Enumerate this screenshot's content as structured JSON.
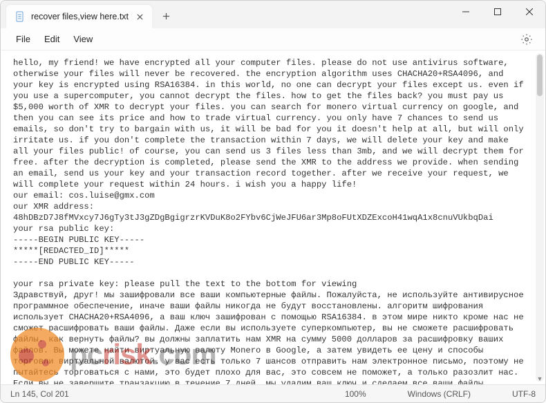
{
  "titlebar": {
    "tab_title": "recover files,view here.txt"
  },
  "menubar": {
    "file": "File",
    "edit": "Edit",
    "view": "View"
  },
  "body_text": "hello, my friend! we have encrypted all your computer files. please do not use antivirus software, otherwise your files will never be recovered. the encryption algorithm uses CHACHA20+RSA4096, and your key is encrypted using RSA16384. in this world, no one can decrypt your files except us. even if you use a supercomputer, you cannot decrypt the files. how to get the files back? you must pay us $5,000 worth of XMR to decrypt your files. you can search for monero virtual currency on google, and then you can see its price and how to trade virtual currency. you only have 7 chances to send us emails, so don't try to bargain with us, it will be bad for you it doesn't help at all, but will only irritate us. if you don't complete the transaction within 7 days, we will delete your key and make all your files public! of course, you can send us 3 files less than 3mb, and we will decrypt them for free. after the decryption is completed, please send the XMR to the address we provide. when sending an email, send us your key and your transaction record together. after we receive your request, we will complete your request within 24 hours. i wish you a happy life!\nour email: cos.luise@gmx.com\nour XMR address:\n48hDBzD7J8fMVxcy7J6gTy3tJ3gZDgBgigrzrKVDuK8o2FYbv6CjWeJFU6ar3Mp8oFUtXDZExcoH41wqA1x8cnuVUkbqDai\nyour rsa public key:\n-----BEGIN PUBLIC KEY-----\n*****[REDACTED_ID]*****\n-----END PUBLIC KEY-----\n\nyour rsa private key: please pull the text to the bottom for viewing\nЗдравствуй, друг! мы зашифровали все ваши компьютерные файлы. Пожалуйста, не используйте антивирусное программное обеспечение, иначе ваши файлы никогда не будут восстановлены. алгоритм шифрования использует CHACHA20+RSA4096, а ваш ключ зашифрован с помощью RSA16384. в этом мире никто кроме нас не сможет расшифровать ваши файлы. Даже если вы используете суперкомпьютер, вы не сможете расшифровать файлы. как вернуть файлы? вы должны заплатить нам XMR на сумму 5000 долларов за расшифровку ваших файлов. Вы можете найти виртуальную валюту Monero в Google, а затем увидеть ее цену и способы торговли виртуальной валютой. у вас есть только 7 шансов отправить нам электронное письмо, поэтому не пытайтесь торговаться с нами, это будет плохо для вас, это совсем не поможет, а только разозлит нас. Если вы не завершите транзакцию в течение 7 дней, мы удалим ваш ключ и сделаем все ваши файлы общедоступными! Конечно, вы можете отправить нам 3 файла размером менее 3 Мб, и мы их бесплатно расшифруем. После завершения расшифровки отправьте XMR на указанный нами адрес. при отправке электронного письма отправьте нам свой ключ и запись транзакции вместе. после получения вашего запроса мы выполним ваш запрос в течение 24 часов. желаю тебе счастливой жизни!",
  "statusbar": {
    "position": "Ln 145, Col 201",
    "zoom": "100%",
    "eol": "Windows (CRLF)",
    "encoding": "UTF-8"
  },
  "watermark": {
    "brand_prefix": "pc",
    "brand_mid": "risk",
    "brand_suffix": ".com"
  }
}
